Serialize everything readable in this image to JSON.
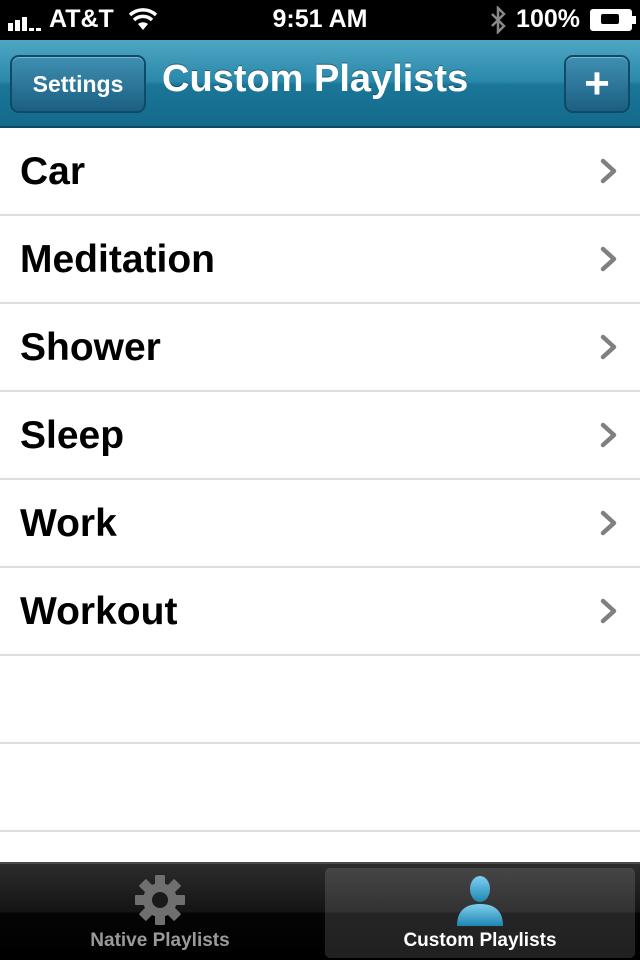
{
  "status_bar": {
    "carrier": "AT&T",
    "time": "9:51 AM",
    "battery": "100%"
  },
  "nav": {
    "settings_label": "Settings",
    "title": "Custom Playlists",
    "add_label": "+"
  },
  "playlists": [
    {
      "name": "Car"
    },
    {
      "name": "Meditation"
    },
    {
      "name": "Shower"
    },
    {
      "name": "Sleep"
    },
    {
      "name": "Work"
    },
    {
      "name": "Workout"
    }
  ],
  "tabs": [
    {
      "label": "Native Playlists",
      "icon": "gear-icon",
      "selected": false
    },
    {
      "label": "Custom Playlists",
      "icon": "person-icon",
      "selected": true
    }
  ],
  "colors": {
    "nav_accent": "#2a88aa",
    "selected_icon": "#2f9cc6"
  }
}
